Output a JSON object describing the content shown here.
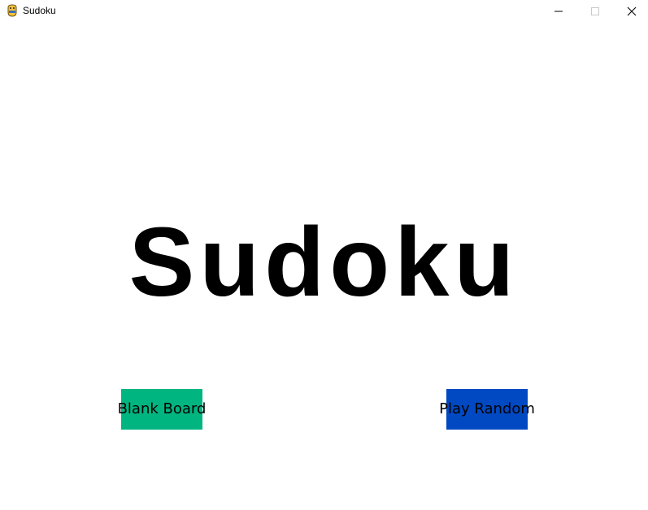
{
  "window": {
    "title": "Sudoku"
  },
  "main": {
    "heading": "Sudoku",
    "buttons": {
      "blank_board": {
        "label": "Blank Board",
        "color": "#00b580"
      },
      "play_random": {
        "label": "Play Random",
        "color": "#0049c2"
      }
    }
  },
  "icons": {
    "app": "pygame-snake-icon",
    "minimize": "minimize-icon",
    "maximize": "maximize-icon",
    "close": "close-icon"
  }
}
